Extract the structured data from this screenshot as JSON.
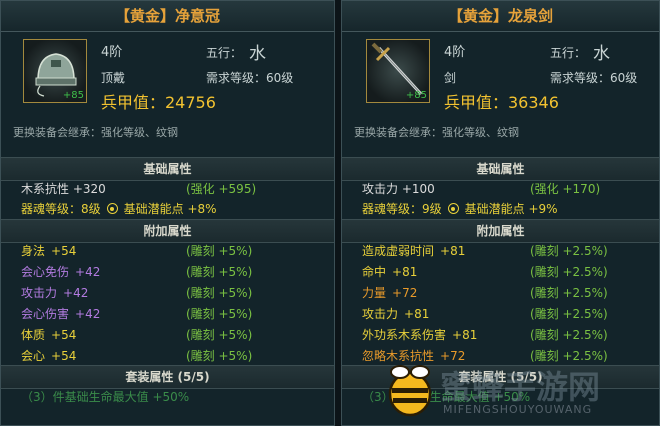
{
  "left": {
    "title": "【黄金】净意冠",
    "enhance": "+85",
    "tier": "4阶",
    "element_label": "五行：",
    "element_glyph": "水",
    "slot": "顶戴",
    "level_req": "需求等级：60级",
    "armor": "兵甲值：24756",
    "inherit": "更换装备会继承：强化等级、纹钢",
    "basic_header": "基础属性",
    "basic_stat": "木系抗性 +320",
    "basic_bonus": "(强化 +595)",
    "soul": "器魂等级：8级",
    "potential": "基础潜能点 +8%",
    "extra_header": "附加属性",
    "extras": [
      {
        "name": "身法",
        "val": "+54",
        "color": "yellow",
        "bonus": "(雕刻 +5%)"
      },
      {
        "name": "会心免伤",
        "val": "+42",
        "color": "purple",
        "bonus": "(雕刻 +5%)"
      },
      {
        "name": "攻击力",
        "val": "+42",
        "color": "purple",
        "bonus": "(雕刻 +5%)"
      },
      {
        "name": "会心伤害",
        "val": "+42",
        "color": "purple",
        "bonus": "(雕刻 +5%)"
      },
      {
        "name": "体质",
        "val": "+54",
        "color": "yellow",
        "bonus": "(雕刻 +5%)"
      },
      {
        "name": "会心",
        "val": "+54",
        "color": "yellow",
        "bonus": "(雕刻 +5%)"
      }
    ],
    "set_header": "套装属性 (5/5)",
    "set_line": "（3）件基础生命最大值 +50%"
  },
  "right": {
    "title": "【黄金】龙泉剑",
    "enhance": "+85",
    "tier": "4阶",
    "element_label": "五行：",
    "element_glyph": "水",
    "slot": "剑",
    "level_req": "需求等级：60级",
    "armor": "兵甲值：36346",
    "inherit": "更换装备会继承：强化等级、纹钢",
    "basic_header": "基础属性",
    "basic_stat": "攻击力 +100",
    "basic_bonus": "(强化 +170)",
    "soul": "器魂等级：9级",
    "potential": "基础潜能点 +9%",
    "extra_header": "附加属性",
    "extras": [
      {
        "name": "造成虚弱时间",
        "val": "+81",
        "color": "yellow",
        "bonus": "(雕刻 +2.5%)"
      },
      {
        "name": "命中",
        "val": "+81",
        "color": "yellow",
        "bonus": "(雕刻 +2.5%)"
      },
      {
        "name": "力量",
        "val": "+72",
        "color": "orange",
        "bonus": "(雕刻 +2.5%)"
      },
      {
        "name": "攻击力",
        "val": "+81",
        "color": "yellow",
        "bonus": "(雕刻 +2.5%)"
      },
      {
        "name": "外功系木系伤害",
        "val": "+81",
        "color": "yellow",
        "bonus": "(雕刻 +2.5%)"
      },
      {
        "name": "忽略木系抗性",
        "val": "+72",
        "color": "orange",
        "bonus": "(雕刻 +2.5%)"
      }
    ],
    "set_header": "套装属性 (5/5)",
    "set_line": "（3）件基础生命最大值 +50%"
  },
  "watermark": {
    "cn": "蜜蜂手游网",
    "en": "MIFENGSHOUYOUWANG"
  }
}
